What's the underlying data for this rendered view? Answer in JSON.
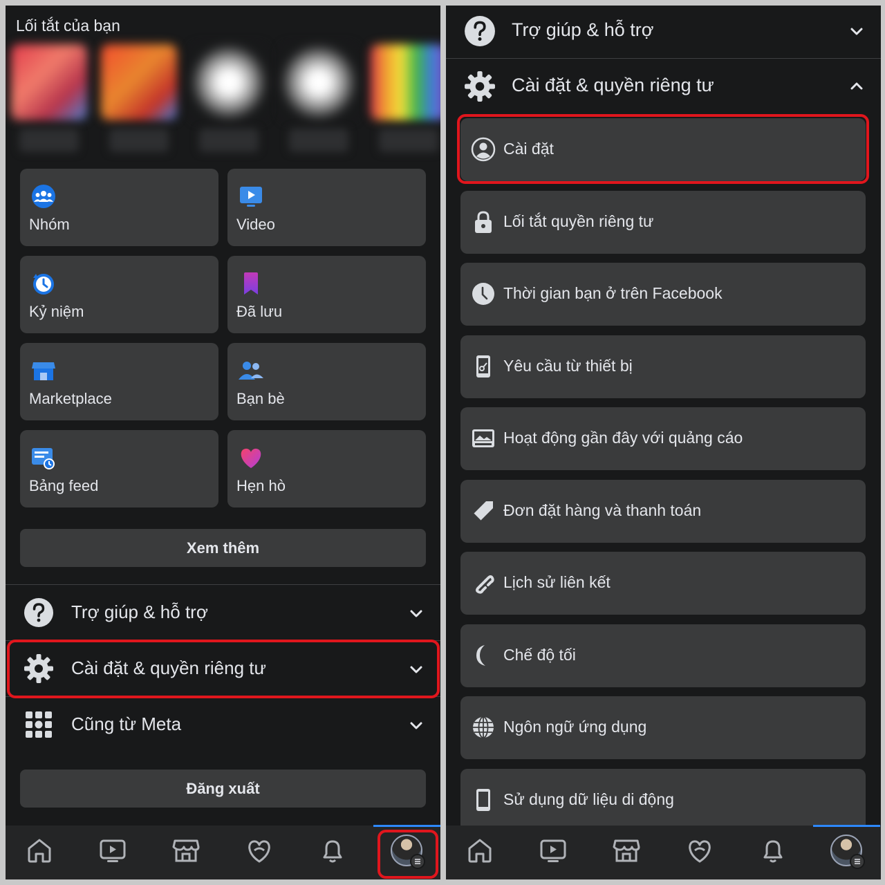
{
  "left": {
    "shortcuts_title": "Lối tắt của bạn",
    "tiles": [
      {
        "label": "Nhóm",
        "icon": "groups-icon"
      },
      {
        "label": "Video",
        "icon": "video-icon"
      },
      {
        "label": "Kỷ niệm",
        "icon": "memories-icon"
      },
      {
        "label": "Đã lưu",
        "icon": "saved-icon"
      },
      {
        "label": "Marketplace",
        "icon": "marketplace-icon"
      },
      {
        "label": "Bạn bè",
        "icon": "friends-icon"
      },
      {
        "label": "Bảng feed",
        "icon": "feeds-icon"
      },
      {
        "label": "Hẹn hò",
        "icon": "dating-icon"
      }
    ],
    "see_more": "Xem thêm",
    "sections": [
      {
        "label": "Trợ giúp & hỗ trợ",
        "icon": "help-icon"
      },
      {
        "label": "Cài đặt & quyền riêng tư",
        "icon": "gear-icon"
      },
      {
        "label": "Cũng từ Meta",
        "icon": "grid-icon"
      }
    ],
    "logout": "Đăng xuất"
  },
  "right": {
    "help_header": "Trợ giúp & hỗ trợ",
    "settings_header": "Cài đặt & quyền riêng tư",
    "items": [
      {
        "label": "Cài đặt",
        "icon": "user-circle-icon"
      },
      {
        "label": "Lối tắt quyền riêng tư",
        "icon": "lock-icon"
      },
      {
        "label": "Thời gian bạn ở trên Facebook",
        "icon": "clock-icon"
      },
      {
        "label": "Yêu cầu từ thiết bị",
        "icon": "device-key-icon"
      },
      {
        "label": "Hoạt động gần đây với quảng cáo",
        "icon": "ad-image-icon"
      },
      {
        "label": "Đơn đặt hàng và thanh toán",
        "icon": "tag-icon"
      },
      {
        "label": "Lịch sử liên kết",
        "icon": "link-icon"
      },
      {
        "label": "Chế độ tối",
        "icon": "moon-icon"
      },
      {
        "label": "Ngôn ngữ ứng dụng",
        "icon": "globe-icon"
      },
      {
        "label": "Sử dụng dữ liệu di động",
        "icon": "phone-icon"
      }
    ]
  },
  "bottom_nav": [
    "home-icon",
    "watch-icon",
    "marketplace-icon",
    "dating-icon",
    "notifications-icon",
    "profile-menu-icon"
  ],
  "colors": {
    "background": "#18191a",
    "card": "#3a3b3c",
    "text": "#e4e6eb",
    "highlight": "#e0161d",
    "accent": "#2d88ff"
  }
}
